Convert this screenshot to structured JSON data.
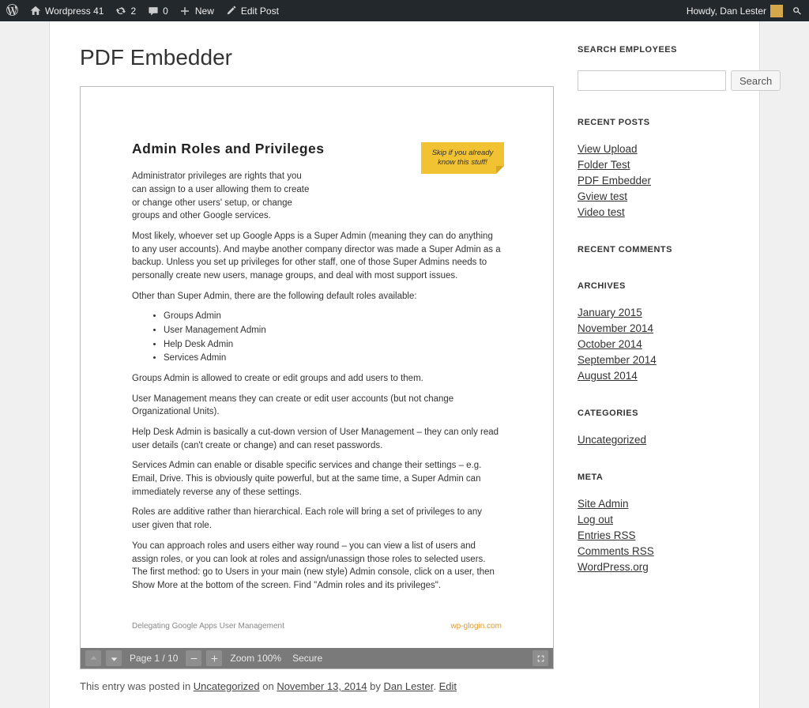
{
  "adminbar": {
    "site_name": "Wordpress 41",
    "update_count": "2",
    "comment_count": "0",
    "new_label": "New",
    "edit_label": "Edit Post",
    "greeting": "Howdy, Dan Lester"
  },
  "post": {
    "title": "PDF Embedder",
    "meta_prefix": "This entry was posted in ",
    "meta_category": "Uncategorized",
    "meta_on": " on ",
    "meta_date": "November 13, 2014",
    "meta_by": " by ",
    "meta_author": "Dan Lester",
    "meta_edit": "Edit"
  },
  "pdf": {
    "heading": "Admin Roles and Privileges",
    "note": "Skip if you already know this stuff!",
    "p1": "Administrator privileges are rights that you can assign to a user allowing them to create or change other users' setup, or change groups and other Google services.",
    "p2": "Most likely, whoever set up Google Apps is a Super Admin (meaning they can do anything to any user accounts). And maybe another company director was made a Super Admin as a backup. Unless you set up privileges for other staff, one of those Super Admins needs to personally create new users, manage groups, and deal with most support issues.",
    "p3": "Other than Super Admin, there are the following default roles available:",
    "roles": [
      "Groups Admin",
      "User Management Admin",
      "Help Desk Admin",
      "Services Admin"
    ],
    "p4": "Groups Admin is allowed to create or edit groups and add users to them.",
    "p5": "User Management means they can create or edit user accounts (but not change Organizational Units).",
    "p6": "Help Desk Admin is basically a cut-down version of User Management – they can only read user details (can't create or change) and can reset passwords.",
    "p7": "Services Admin can enable or disable specific services and change their settings – e.g. Email, Drive. This is obviously quite powerful, but at the same time, a Super Admin can immediately reverse any of these settings.",
    "p8": "Roles are additive rather than hierarchical. Each role will bring a set of privileges to any user given that role.",
    "p9": "You can approach roles and users either way round – you can view a list of users and assign roles, or you can look at roles and assign/unassign those roles to selected users. The first method: go to Users in your main (new style) Admin console, click on a user, then Show More at the bottom of the screen. Find \"Admin roles and its privileges\".",
    "footer_left": "Delegating Google Apps User Management",
    "footer_right": "wp-glogin.com",
    "toolbar": {
      "page_label": "Page 1 / 10",
      "zoom_label": "Zoom 100%",
      "secure_label": "Secure"
    }
  },
  "sidebar": {
    "search": {
      "title": "SEARCH EMPLOYEES",
      "button": "Search"
    },
    "recent_posts": {
      "title": "RECENT POSTS",
      "items": [
        "View Upload",
        "Folder Test",
        "PDF Embedder",
        "Gview test",
        "Video test"
      ]
    },
    "recent_comments": {
      "title": "RECENT COMMENTS"
    },
    "archives": {
      "title": "ARCHIVES",
      "items": [
        "January 2015",
        "November 2014",
        "October 2014",
        "September 2014",
        "August 2014"
      ]
    },
    "categories": {
      "title": "CATEGORIES",
      "items": [
        "Uncategorized"
      ]
    },
    "meta": {
      "title": "META",
      "items": [
        "Site Admin",
        "Log out",
        "Entries RSS",
        "Comments RSS",
        "WordPress.org"
      ]
    }
  }
}
